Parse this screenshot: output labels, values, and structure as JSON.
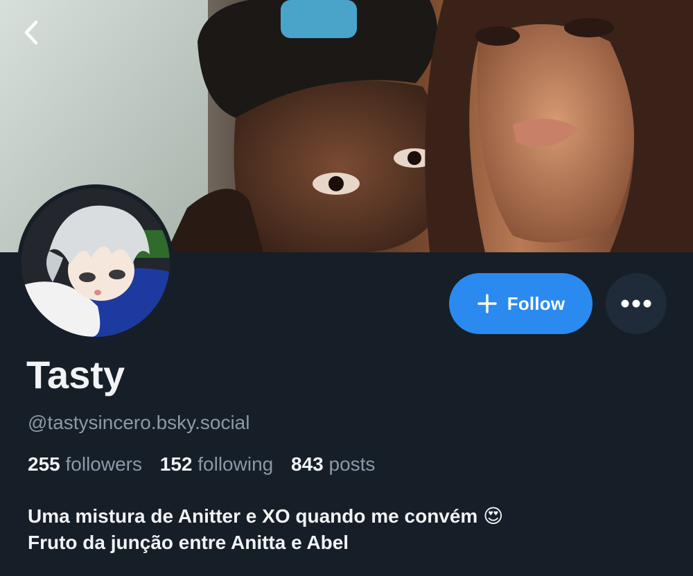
{
  "profile": {
    "display_name": "Tasty",
    "handle": "@tastysincero.bsky.social",
    "stats": {
      "followers_count": "255",
      "followers_label": "followers",
      "following_count": "152",
      "following_label": "following",
      "posts_count": "843",
      "posts_label": "posts"
    },
    "bio": {
      "line1": "Uma mistura de Anitter e XO quando me convém 😍",
      "line2": "Fruto da junção entre Anitta e Abel"
    }
  },
  "actions": {
    "follow_label": "Follow"
  },
  "icons": {
    "back": "chevron-left-icon",
    "follow": "plus-icon",
    "more": "ellipsis-icon"
  },
  "colors": {
    "background": "#161e27",
    "accent": "#2b8af0",
    "secondary_button": "#1f2b38",
    "text_primary": "#f1f3f5",
    "text_secondary": "#8c99a8"
  }
}
